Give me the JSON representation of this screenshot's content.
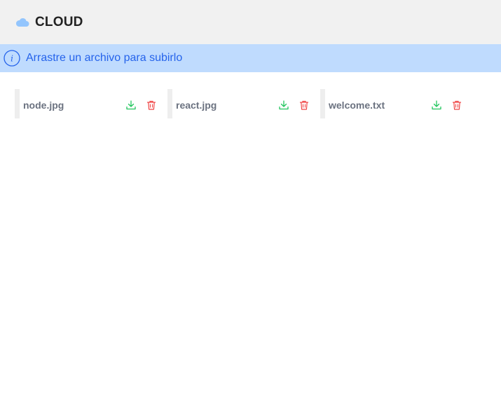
{
  "header": {
    "title": "CLOUD",
    "icon": "cloud-icon",
    "background": "#f1f1f1",
    "icon_color": "#93c5fd"
  },
  "banner": {
    "icon": "info-icon",
    "message": "Arrastre un archivo para subirlo",
    "background": "#bfdbfe",
    "text_color": "#2563eb"
  },
  "files": [
    {
      "name": "node.jpg",
      "download_icon": "download-icon",
      "delete_icon": "trash-icon"
    },
    {
      "name": "react.jpg",
      "download_icon": "download-icon",
      "delete_icon": "trash-icon"
    },
    {
      "name": "welcome.txt",
      "download_icon": "download-icon",
      "delete_icon": "trash-icon"
    }
  ],
  "colors": {
    "download": "#22c55e",
    "delete": "#ef4444",
    "filename": "#6b7280"
  }
}
